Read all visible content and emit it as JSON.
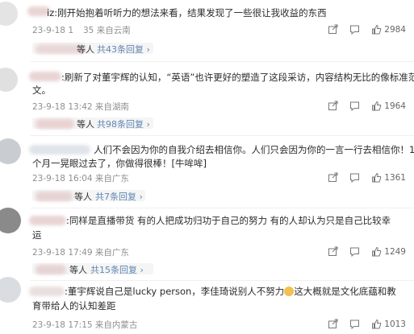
{
  "comments": [
    {
      "user_suffix": "iz:",
      "text": "刚开始抱着听听力的想法来看，结果发现了一些很让我收益的东西",
      "timestamp": "23-9-18 1",
      "timestamp_tail": "35 来自云南",
      "likes": "2984",
      "reply_link": "共43条回复",
      "reply_prefix": "等人"
    },
    {
      "user_suffix": ":",
      "text_line1": "刷新了对董宇辉的认知，“英语”也许更好的塑造了这段采访，内容结构无比的像标准范",
      "text_line2": "文。",
      "timestamp": "23-9-18 13:42 来自湖南",
      "likes": "1964",
      "reply_prefix": "等人",
      "reply_link": "共98条回复"
    },
    {
      "user_suffix": "",
      "text_line1": "人们不会因为你的自我介绍去相信你。人们只会因为你的一言一行去相信你！15",
      "text_line2": "个月一晃眼过去了，你做得很棒！[牛哞哞]",
      "timestamp": "23-9-18 16:04 来自广东",
      "likes": "1361",
      "reply_prefix": "等人",
      "reply_link": "共7条回复"
    },
    {
      "user_suffix": ":",
      "text_line1": "同样是直播带货 有的人把成功归功于自己的努力 有的人却认为只是自己比较幸",
      "text_line2": "运",
      "timestamp": "23-9-18 17:49 来自广东",
      "likes": "1249",
      "reply_prefix": "等人",
      "reply_link": "共15条回复"
    },
    {
      "user_suffix": ":",
      "text_line1a": "董宇辉说自己是lucky person，李佳琦说别人不努力",
      "text_line1b": "这大概就是文化底蕴和教",
      "text_line2": "育带给人的认知差距",
      "timestamp": "23-9-18 17:15 来自内蒙古",
      "likes": "1013"
    }
  ],
  "icons": {
    "share": "share-icon",
    "comment": "comment-icon",
    "like": "thumbs-up-icon"
  },
  "colors": {
    "link": "#5f86b4",
    "meta": "#8f8f8f",
    "text": "#2b2b2b"
  }
}
